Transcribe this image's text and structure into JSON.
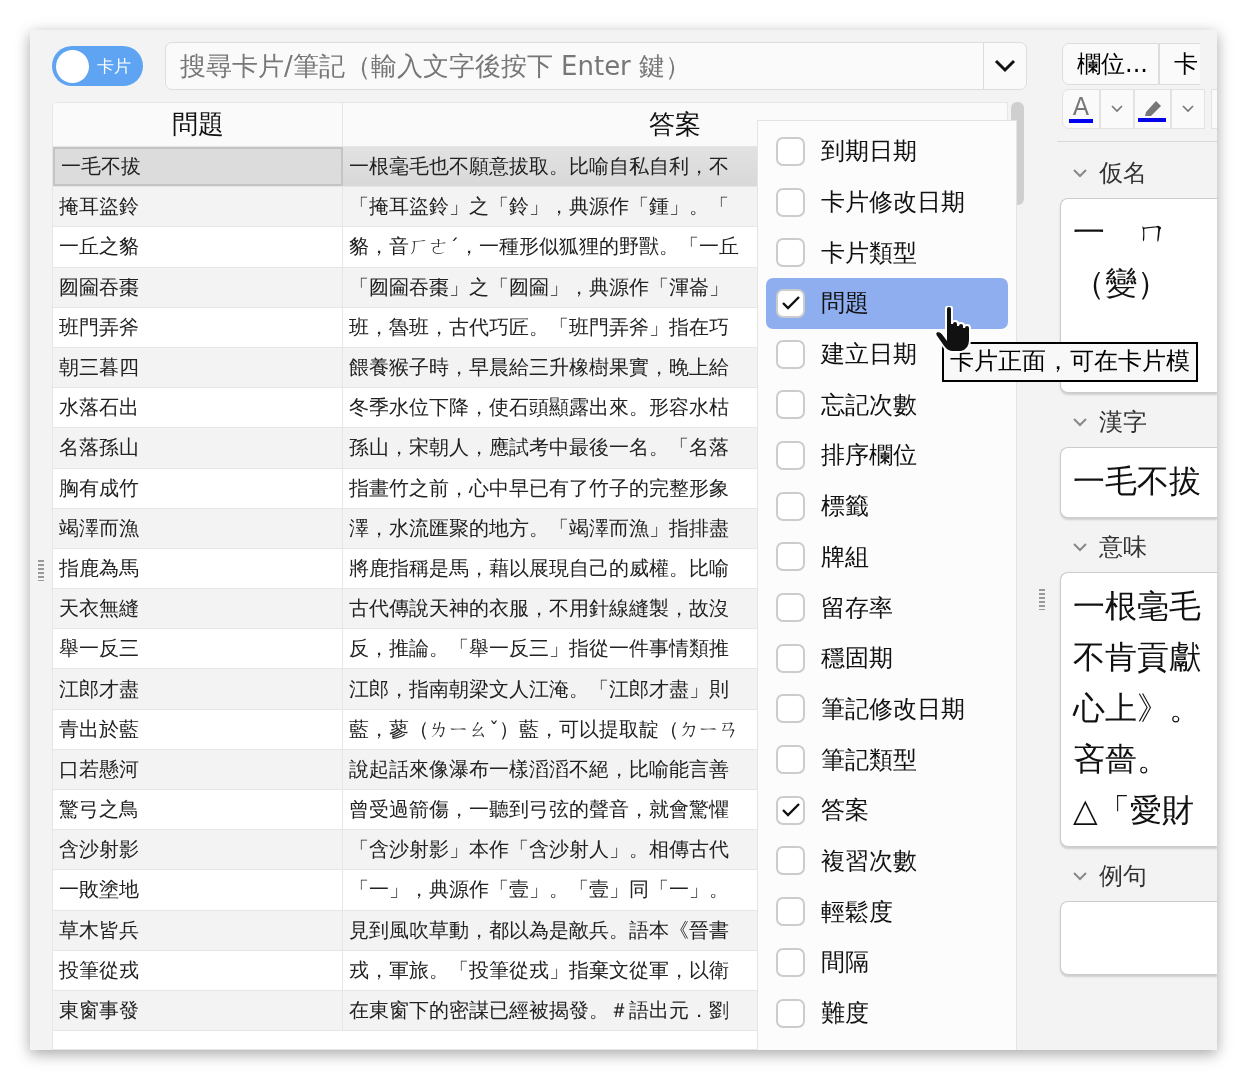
{
  "toggle": {
    "label": "卡片"
  },
  "search": {
    "placeholder": "搜尋卡片/筆記（輸入文字後按下 Enter 鍵）"
  },
  "table": {
    "columns": [
      "問題",
      "答案"
    ],
    "rows": [
      {
        "selected": true,
        "cells": [
          "一毛不拔",
          "一根毫毛也不願意拔取。比喻自私自利，不"
        ]
      },
      {
        "selected": false,
        "cells": [
          "掩耳盜鈴",
          "「掩耳盜鈴」之「鈴」，典源作「鍾」。「"
        ]
      },
      {
        "selected": false,
        "cells": [
          "一丘之貉",
          "貉，音ㄏㄜˊ，一種形似狐狸的野獸。「一丘"
        ]
      },
      {
        "selected": false,
        "cells": [
          "囫圇吞棗",
          "「囫圇吞棗」之「囫圇」，典源作「渾崙」"
        ]
      },
      {
        "selected": false,
        "cells": [
          "班門弄斧",
          "班，魯班，古代巧匠。「班門弄斧」指在巧"
        ]
      },
      {
        "selected": false,
        "cells": [
          "朝三暮四",
          "餵養猴子時，早晨給三升橡樹果實，晚上給"
        ]
      },
      {
        "selected": false,
        "cells": [
          "水落石出",
          "冬季水位下降，使石頭顯露出來。形容水枯"
        ]
      },
      {
        "selected": false,
        "cells": [
          "名落孫山",
          "孫山，宋朝人，應試考中最後一名。「名落"
        ]
      },
      {
        "selected": false,
        "cells": [
          "胸有成竹",
          "指畫竹之前，心中早已有了竹子的完整形象"
        ]
      },
      {
        "selected": false,
        "cells": [
          "竭澤而漁",
          "澤，水流匯聚的地方。「竭澤而漁」指排盡"
        ]
      },
      {
        "selected": false,
        "cells": [
          "指鹿為馬",
          "將鹿指稱是馬，藉以展現自己的威權。比喻"
        ]
      },
      {
        "selected": false,
        "cells": [
          "天衣無縫",
          "古代傳說天神的衣服，不用針線縫製，故沒"
        ]
      },
      {
        "selected": false,
        "cells": [
          "舉一反三",
          "反，推論。「舉一反三」指從一件事情類推"
        ]
      },
      {
        "selected": false,
        "cells": [
          "江郎才盡",
          "江郎，指南朝梁文人江淹。「江郎才盡」則"
        ]
      },
      {
        "selected": false,
        "cells": [
          "青出於藍",
          "藍，蓼（ㄌㄧㄠˇ）藍，可以提取靛（ㄉㄧㄢ"
        ]
      },
      {
        "selected": false,
        "cells": [
          "口若懸河",
          "說起話來像瀑布一樣滔滔不絕，比喻能言善"
        ]
      },
      {
        "selected": false,
        "cells": [
          "驚弓之鳥",
          "曾受過箭傷，一聽到弓弦的聲音，就會驚懼"
        ]
      },
      {
        "selected": false,
        "cells": [
          "含沙射影",
          "「含沙射影」本作「含沙射人」。相傳古代"
        ]
      },
      {
        "selected": false,
        "cells": [
          "一敗塗地",
          "「一」，典源作「壹」。「壹」同「一」。"
        ]
      },
      {
        "selected": false,
        "cells": [
          "草木皆兵",
          "見到風吹草動，都以為是敵兵。語本《晉書"
        ]
      },
      {
        "selected": false,
        "cells": [
          "投筆從戎",
          "戎，軍旅。「投筆從戎」指棄文從軍，以衛"
        ]
      },
      {
        "selected": false,
        "cells": [
          "東窗事發",
          "在東窗下的密謀已經被揭發。＃語出元．劉"
        ]
      }
    ]
  },
  "column_menu": {
    "items": [
      {
        "label": "到期日期",
        "checked": false,
        "selected": false
      },
      {
        "label": "卡片修改日期",
        "checked": false,
        "selected": false
      },
      {
        "label": "卡片類型",
        "checked": false,
        "selected": false
      },
      {
        "label": "問題",
        "checked": true,
        "selected": true
      },
      {
        "label": "建立日期",
        "checked": false,
        "selected": false
      },
      {
        "label": "忘記次數",
        "checked": false,
        "selected": false
      },
      {
        "label": "排序欄位",
        "checked": false,
        "selected": false
      },
      {
        "label": "標籤",
        "checked": false,
        "selected": false
      },
      {
        "label": "牌組",
        "checked": false,
        "selected": false
      },
      {
        "label": "留存率",
        "checked": false,
        "selected": false
      },
      {
        "label": "穩固期",
        "checked": false,
        "selected": false
      },
      {
        "label": "筆記修改日期",
        "checked": false,
        "selected": false
      },
      {
        "label": "筆記類型",
        "checked": false,
        "selected": false
      },
      {
        "label": "答案",
        "checked": true,
        "selected": false
      },
      {
        "label": "複習次數",
        "checked": false,
        "selected": false
      },
      {
        "label": "輕鬆度",
        "checked": false,
        "selected": false
      },
      {
        "label": "間隔",
        "checked": false,
        "selected": false
      },
      {
        "label": "難度",
        "checked": false,
        "selected": false
      }
    ]
  },
  "tooltip": {
    "text": "卡片正面，可在卡片模"
  },
  "editor": {
    "buttons": [
      "欄位...",
      "卡"
    ],
    "text_color_label": "A",
    "fields": [
      {
        "label": "仮名",
        "lines": [
          "一　ㄇ",
          "（變）"
        ]
      },
      {
        "label": "漢字",
        "lines": [
          "一毛不拔"
        ]
      },
      {
        "label": "意味",
        "lines": [
          "一根毫毛",
          "不肯貢獻",
          "心上》。",
          "吝嗇。",
          "△「愛財"
        ]
      },
      {
        "label": "例句"
      }
    ]
  }
}
